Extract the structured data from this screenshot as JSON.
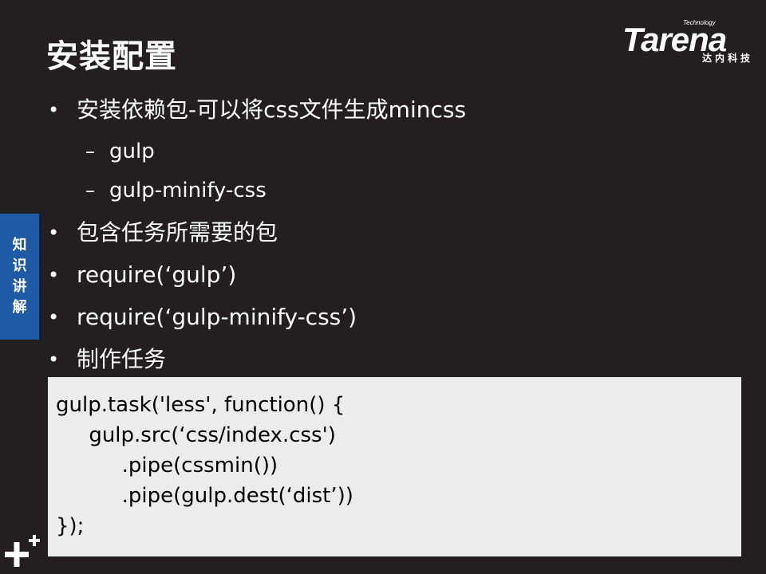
{
  "slide": {
    "title": "安装配置",
    "side_tab": [
      "知",
      "识",
      "讲",
      "解"
    ],
    "bullets": [
      {
        "level": 1,
        "text": "安装依赖包-可以将css文件生成mincss"
      },
      {
        "level": 2,
        "text": "gulp"
      },
      {
        "level": 2,
        "text": "gulp-minify-css"
      },
      {
        "level": 1,
        "text": "包含任务所需要的包"
      },
      {
        "level": 1,
        "text": "require(‘gulp’)"
      },
      {
        "level": 1,
        "text": "require(‘gulp-minify-css’)"
      },
      {
        "level": 1,
        "text": "制作任务"
      }
    ],
    "bullet_mark": "•",
    "sub_mark": "–",
    "code": [
      "gulp.task('less', function() {",
      "     gulp.src(‘css/index.css')",
      "          .pipe(cssmin())",
      "          .pipe(gulp.dest(‘dist’))",
      "});"
    ]
  },
  "logo": {
    "word": "Tarena",
    "tagline": "Technology",
    "chinese": "达内科技"
  },
  "colors": {
    "background": "#231f20",
    "side_tab": "#1f5aa6",
    "code_background": "#ececec"
  },
  "icons": {
    "corner": "plus-plus-icon"
  }
}
